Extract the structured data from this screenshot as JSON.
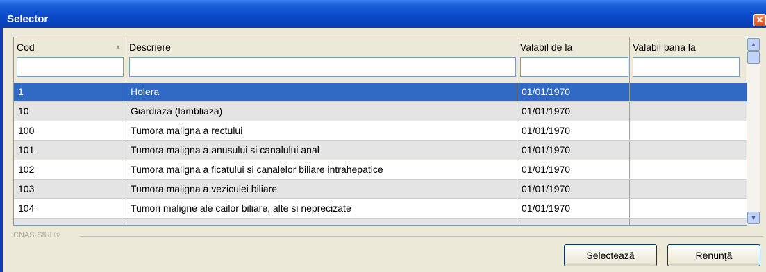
{
  "window": {
    "title": "Selector",
    "close_glyph": "✕"
  },
  "grid": {
    "columns": [
      {
        "label": "Cod",
        "filter": ""
      },
      {
        "label": "Descriere",
        "filter": ""
      },
      {
        "label": "Valabil de la",
        "filter": ""
      },
      {
        "label": "Valabil pana la",
        "filter": ""
      }
    ],
    "sort_glyph": "▲",
    "rows": [
      {
        "cod": "1",
        "descriere": "Holera",
        "de_la": "01/01/1970",
        "pana_la": ""
      },
      {
        "cod": "10",
        "descriere": "Giardiaza (lambliaza)",
        "de_la": "01/01/1970",
        "pana_la": ""
      },
      {
        "cod": "100",
        "descriere": "Tumora maligna a rectului",
        "de_la": "01/01/1970",
        "pana_la": ""
      },
      {
        "cod": "101",
        "descriere": "Tumora maligna a anusului si canalului anal",
        "de_la": "01/01/1970",
        "pana_la": ""
      },
      {
        "cod": "102",
        "descriere": "Tumora maligna a ficatului si canalelor biliare intrahepatice",
        "de_la": "01/01/1970",
        "pana_la": ""
      },
      {
        "cod": "103",
        "descriere": "Tumora maligna a veziculei biliare",
        "de_la": "01/01/1970",
        "pana_la": ""
      },
      {
        "cod": "104",
        "descriere": "Tumori maligne ale cailor biliare, alte si neprecizate",
        "de_la": "01/01/1970",
        "pana_la": ""
      }
    ],
    "selected_row_index": 0,
    "scroll_up_glyph": "▲",
    "scroll_down_glyph": "▼"
  },
  "footer": {
    "text": "CNAS-SIUI ®"
  },
  "buttons": {
    "select_first": "S",
    "select_rest": "electează",
    "cancel_first": "R",
    "cancel_rest": "enunţă"
  },
  "colors": {
    "selection": "#316ac5",
    "titlebar": "#0a48c6",
    "alt_row": "#e4e4e4"
  }
}
